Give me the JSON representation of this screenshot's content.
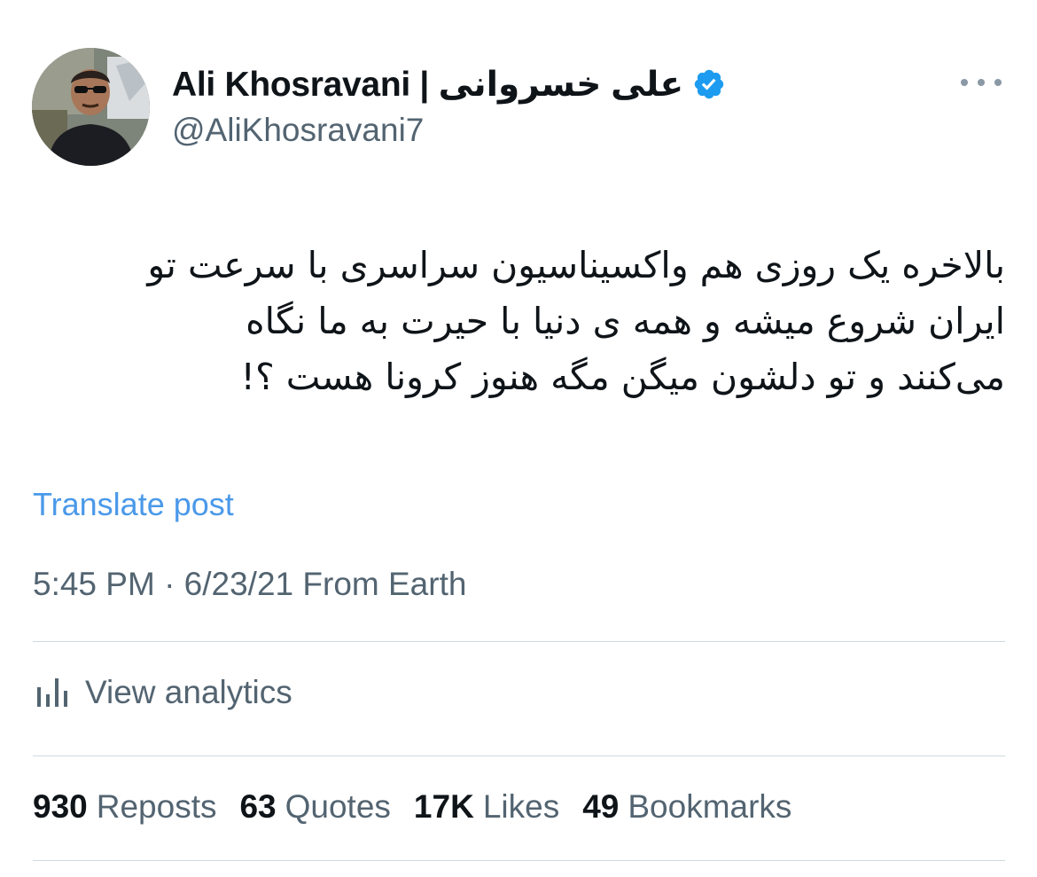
{
  "author": {
    "display_name": "Ali Khosravani | علی خسروانی",
    "handle": "@AliKhosravani7",
    "verified": true
  },
  "tweet": {
    "text_lines": [
      "بالاخره یک روزی هم واکسیناسیون سراسری با سرعت تو",
      "ایران شروع میشه و همه ی دنیا با حیرت به ما نگاه",
      "می‌کنند و تو دلشون میگن مگه هنوز کرونا هست ؟!"
    ],
    "translate_label": "Translate post",
    "timestamp": "5:45 PM · 6/23/21 From Earth"
  },
  "analytics": {
    "label": "View analytics"
  },
  "stats": [
    {
      "value": "930",
      "label": "Reposts"
    },
    {
      "value": "63",
      "label": "Quotes"
    },
    {
      "value": "17K",
      "label": "Likes"
    },
    {
      "value": "49",
      "label": "Bookmarks"
    }
  ],
  "colors": {
    "link": "#4a99e9",
    "secondary_text": "#536471",
    "verified": "#1d9bf0",
    "divider": "#cfd9de"
  },
  "icons": {
    "verified": "verified-badge-icon",
    "more": "more-horizontal-icon",
    "analytics": "bar-chart-icon"
  }
}
